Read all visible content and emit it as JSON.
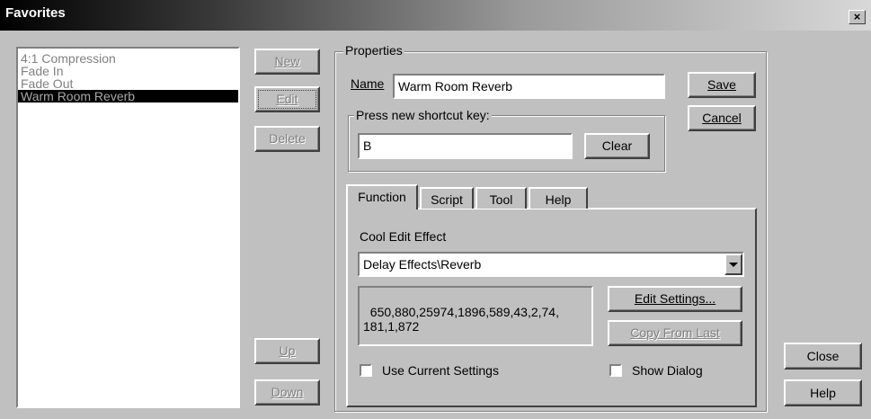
{
  "window": {
    "title": "Favorites",
    "close_glyph": "×"
  },
  "favorites_list": {
    "items": [
      {
        "label": "4:1 Compression",
        "selected": false
      },
      {
        "label": "Fade In",
        "selected": false
      },
      {
        "label": "Fade Out",
        "selected": false
      },
      {
        "label": "Warm Room Reverb",
        "selected": true
      }
    ]
  },
  "list_buttons": {
    "new_label": "New",
    "edit_label": "Edit",
    "delete_label": "Delete",
    "up_label": "Up",
    "down_label": "Down"
  },
  "properties": {
    "legend": "Properties",
    "name_label": "Name",
    "name_value": "Warm Room Reverb",
    "save_label": "Save",
    "cancel_label": "Cancel",
    "shortcut_legend": "Press new shortcut key:",
    "shortcut_value": "B",
    "clear_label": "Clear"
  },
  "tabs": [
    {
      "label": "Function",
      "active": true
    },
    {
      "label": "Script",
      "active": false
    },
    {
      "label": "Tool",
      "active": false
    },
    {
      "label": "Help",
      "active": false
    }
  ],
  "function_panel": {
    "effect_label": "Cool Edit Effect",
    "effect_selected": "Delay Effects\\Reverb",
    "settings_text": "650,880,25974,1896,589,43,2,74,\n181,1,872",
    "edit_settings_label": "Edit Settings...",
    "copy_from_last_label": "Copy From Last",
    "use_current_settings_label": "Use Current Settings",
    "use_current_settings_checked": false,
    "show_dialog_label": "Show Dialog",
    "show_dialog_checked": false
  },
  "dialog_buttons": {
    "close_label": "Close",
    "help_label": "Help"
  }
}
